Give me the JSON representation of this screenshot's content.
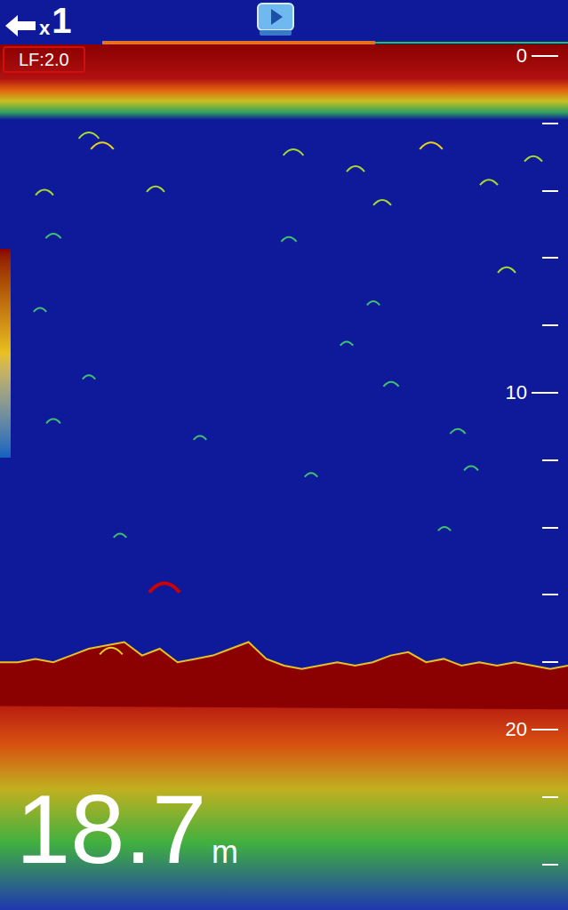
{
  "top_bar": {
    "zoom": {
      "prefix": "x",
      "value": "1"
    }
  },
  "history": {
    "start": 0.18,
    "end": 0.66
  },
  "frequency": {
    "label": "LF:2.0"
  },
  "scale": {
    "labels": [
      {
        "text": "0",
        "depth": 0
      },
      {
        "text": "10",
        "depth": 10
      },
      {
        "text": "20",
        "depth": 20
      }
    ],
    "tick_step": 2,
    "max_depth": 24
  },
  "depth_reading": {
    "value": "18.7",
    "unit": "m"
  },
  "echogram": {
    "bottom_depth_m": [
      18.0,
      18.0,
      17.9,
      18.0,
      17.8,
      17.6,
      17.5,
      17.4,
      17.8,
      17.6,
      18.0,
      17.9,
      17.8,
      17.6,
      17.4,
      17.9,
      18.1,
      18.2,
      18.1,
      18.0,
      18.1,
      18.0,
      17.8,
      17.7,
      18.0,
      17.9,
      18.1,
      18.0,
      18.1,
      18.0,
      18.1,
      18.2,
      18.1
    ],
    "targets": [
      {
        "ping": 20,
        "depth": 2.3,
        "level": 0.6
      },
      {
        "ping": 23,
        "depth": 2.6,
        "level": 0.7
      },
      {
        "ping": 35,
        "depth": 3.9,
        "level": 0.5
      },
      {
        "ping": 66,
        "depth": 2.8,
        "level": 0.6
      },
      {
        "ping": 80,
        "depth": 3.3,
        "level": 0.5
      },
      {
        "ping": 97,
        "depth": 2.6,
        "level": 0.7
      },
      {
        "ping": 110,
        "depth": 3.7,
        "level": 0.5
      },
      {
        "ping": 120,
        "depth": 3.0,
        "level": 0.5
      },
      {
        "ping": 10,
        "depth": 4.0,
        "level": 0.5
      },
      {
        "ping": 86,
        "depth": 4.3,
        "level": 0.5
      },
      {
        "ping": 12,
        "depth": 5.3,
        "level": 0.4
      },
      {
        "ping": 65,
        "depth": 5.4,
        "level": 0.4
      },
      {
        "ping": 114,
        "depth": 6.3,
        "level": 0.5
      },
      {
        "ping": 9,
        "depth": 7.5,
        "level": 0.3
      },
      {
        "ping": 84,
        "depth": 7.3,
        "level": 0.3
      },
      {
        "ping": 78,
        "depth": 8.5,
        "level": 0.3
      },
      {
        "ping": 20,
        "depth": 9.5,
        "level": 0.3
      },
      {
        "ping": 88,
        "depth": 9.7,
        "level": 0.4
      },
      {
        "ping": 12,
        "depth": 10.8,
        "level": 0.35
      },
      {
        "ping": 103,
        "depth": 11.1,
        "level": 0.4
      },
      {
        "ping": 45,
        "depth": 11.3,
        "level": 0.3
      },
      {
        "ping": 70,
        "depth": 12.4,
        "level": 0.3
      },
      {
        "ping": 106,
        "depth": 12.2,
        "level": 0.35
      },
      {
        "ping": 27,
        "depth": 14.2,
        "level": 0.3
      },
      {
        "ping": 100,
        "depth": 14.0,
        "level": 0.3
      },
      {
        "ping": 37,
        "depth": 15.7,
        "level": 1.0
      },
      {
        "ping": 25,
        "depth": 17.6,
        "level": 0.7
      }
    ]
  }
}
